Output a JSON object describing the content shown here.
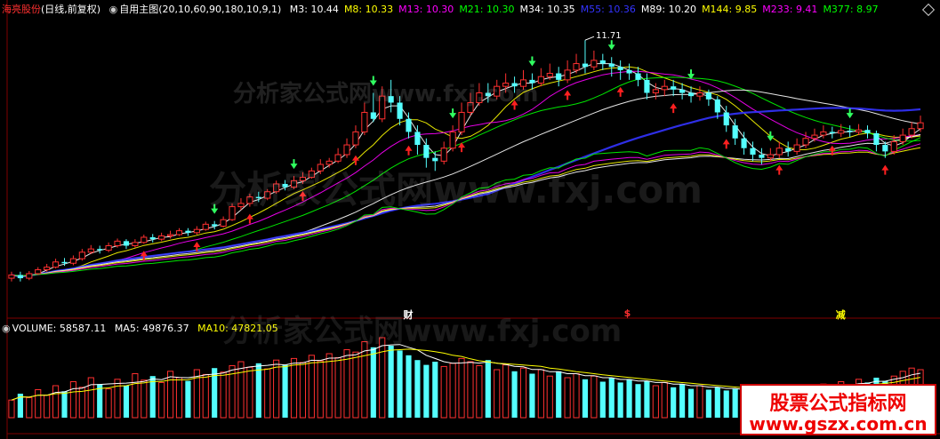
{
  "chart_data": {
    "type": "candlestick",
    "stock_name": "海亮股份",
    "period_label": "(日线,前复权)",
    "formula_name": "自用主图(20,10,60,90,180,10,9,1)",
    "high_marker": "11.71",
    "ma_legend": [
      {
        "label": "M3: 10.44",
        "color": "#ffffff"
      },
      {
        "label": "M8: 10.33",
        "color": "#ffff00"
      },
      {
        "label": "M13: 10.30",
        "color": "#ff00ff"
      },
      {
        "label": "M21: 10.30",
        "color": "#00ff00"
      },
      {
        "label": "M34: 10.35",
        "color": "#ffffff"
      },
      {
        "label": "M55: 10.36",
        "color": "#3333ff"
      },
      {
        "label": "M89: 10.20",
        "color": "#ffffff"
      },
      {
        "label": "M144: 9.85",
        "color": "#ffff00"
      },
      {
        "label": "M233: 9.41",
        "color": "#ff00ff"
      },
      {
        "label": "M377: 8.97",
        "color": "#00ff00"
      }
    ],
    "events": [
      {
        "label": "财",
        "color": "#ffffff",
        "index": 45
      },
      {
        "label": "$",
        "color": "#ff3030",
        "index": 70
      },
      {
        "label": "减",
        "color": "#ffff00",
        "index": 94
      }
    ],
    "candles": [
      [
        8.05,
        8.1,
        8.15,
        8.0
      ],
      [
        8.1,
        8.05,
        8.15,
        8.0
      ],
      [
        8.05,
        8.12,
        8.16,
        8.02
      ],
      [
        8.12,
        8.18,
        8.22,
        8.1
      ],
      [
        8.18,
        8.22,
        8.27,
        8.15
      ],
      [
        8.22,
        8.3,
        8.35,
        8.2
      ],
      [
        8.3,
        8.28,
        8.36,
        8.24
      ],
      [
        8.28,
        8.35,
        8.4,
        8.25
      ],
      [
        8.35,
        8.45,
        8.5,
        8.32
      ],
      [
        8.45,
        8.5,
        8.56,
        8.42
      ],
      [
        8.5,
        8.48,
        8.55,
        8.43
      ],
      [
        8.48,
        8.55,
        8.6,
        8.45
      ],
      [
        8.55,
        8.62,
        8.66,
        8.52
      ],
      [
        8.62,
        8.55,
        8.65,
        8.5
      ],
      [
        8.55,
        8.6,
        8.65,
        8.52
      ],
      [
        8.6,
        8.68,
        8.72,
        8.58
      ],
      [
        8.68,
        8.65,
        8.73,
        8.6
      ],
      [
        8.65,
        8.7,
        8.75,
        8.62
      ],
      [
        8.7,
        8.72,
        8.78,
        8.66
      ],
      [
        8.72,
        8.78,
        8.82,
        8.7
      ],
      [
        8.78,
        8.75,
        8.82,
        8.7
      ],
      [
        8.75,
        8.8,
        8.85,
        8.72
      ],
      [
        8.8,
        8.88,
        8.92,
        8.78
      ],
      [
        8.88,
        8.85,
        8.93,
        8.8
      ],
      [
        8.85,
        8.95,
        9.0,
        8.83
      ],
      [
        8.95,
        9.15,
        9.2,
        8.93
      ],
      [
        9.15,
        9.2,
        9.28,
        9.1
      ],
      [
        9.2,
        9.3,
        9.35,
        9.15
      ],
      [
        9.3,
        9.28,
        9.38,
        9.22
      ],
      [
        9.28,
        9.38,
        9.42,
        9.25
      ],
      [
        9.38,
        9.5,
        9.55,
        9.35
      ],
      [
        9.5,
        9.45,
        9.56,
        9.4
      ],
      [
        9.45,
        9.55,
        9.62,
        9.42
      ],
      [
        9.55,
        9.6,
        9.68,
        9.5
      ],
      [
        9.6,
        9.7,
        9.75,
        9.58
      ],
      [
        9.7,
        9.8,
        9.88,
        9.65
      ],
      [
        9.8,
        9.85,
        9.9,
        9.75
      ],
      [
        9.85,
        9.95,
        10.05,
        9.82
      ],
      [
        9.95,
        10.1,
        10.2,
        9.9
      ],
      [
        10.1,
        10.3,
        10.4,
        10.05
      ],
      [
        10.3,
        10.6,
        10.75,
        10.25
      ],
      [
        10.6,
        10.5,
        10.9,
        10.45
      ],
      [
        10.5,
        10.85,
        11.0,
        10.45
      ],
      [
        10.85,
        10.75,
        11.1,
        10.6
      ],
      [
        10.75,
        10.5,
        10.85,
        10.4
      ],
      [
        10.5,
        10.3,
        10.6,
        10.2
      ],
      [
        10.3,
        10.1,
        10.4,
        9.95
      ],
      [
        10.1,
        9.9,
        10.2,
        9.75
      ],
      [
        9.9,
        9.85,
        10.0,
        9.7
      ],
      [
        9.85,
        10.05,
        10.15,
        9.8
      ],
      [
        10.05,
        10.3,
        10.4,
        10.0
      ],
      [
        10.3,
        10.6,
        10.75,
        10.25
      ],
      [
        10.6,
        10.75,
        10.9,
        10.55
      ],
      [
        10.75,
        10.9,
        11.05,
        10.7
      ],
      [
        10.9,
        10.85,
        11.05,
        10.75
      ],
      [
        10.85,
        11.0,
        11.1,
        10.8
      ],
      [
        11.0,
        11.05,
        11.2,
        10.9
      ],
      [
        11.05,
        11.0,
        11.15,
        10.9
      ],
      [
        11.0,
        11.1,
        11.25,
        10.95
      ],
      [
        11.1,
        11.05,
        11.2,
        10.95
      ],
      [
        11.05,
        11.15,
        11.28,
        11.0
      ],
      [
        11.15,
        11.2,
        11.35,
        11.1
      ],
      [
        11.2,
        11.1,
        11.3,
        11.0
      ],
      [
        11.1,
        11.25,
        11.4,
        11.05
      ],
      [
        11.25,
        11.35,
        11.5,
        11.2
      ],
      [
        11.35,
        11.3,
        11.71,
        11.2
      ],
      [
        11.3,
        11.4,
        11.55,
        11.25
      ],
      [
        11.4,
        11.35,
        11.5,
        11.25
      ],
      [
        11.35,
        11.3,
        11.45,
        11.15
      ],
      [
        11.3,
        11.25,
        11.4,
        11.1
      ],
      [
        11.25,
        11.2,
        11.35,
        11.1
      ],
      [
        11.2,
        11.1,
        11.3,
        11.0
      ],
      [
        11.1,
        10.9,
        11.2,
        10.8
      ],
      [
        10.9,
        10.95,
        11.05,
        10.8
      ],
      [
        10.95,
        11.0,
        11.1,
        10.85
      ],
      [
        11.0,
        10.95,
        11.1,
        10.85
      ],
      [
        10.95,
        10.9,
        11.05,
        10.8
      ],
      [
        10.9,
        10.85,
        11.0,
        10.75
      ],
      [
        10.85,
        10.9,
        11.0,
        10.78
      ],
      [
        10.9,
        10.8,
        10.95,
        10.7
      ],
      [
        10.8,
        10.6,
        10.85,
        10.5
      ],
      [
        10.6,
        10.4,
        10.7,
        10.3
      ],
      [
        10.4,
        10.2,
        10.5,
        10.1
      ],
      [
        10.2,
        10.05,
        10.3,
        9.95
      ],
      [
        10.05,
        9.95,
        10.15,
        9.85
      ],
      [
        9.95,
        9.9,
        10.05,
        9.8
      ],
      [
        9.9,
        9.95,
        10.05,
        9.85
      ],
      [
        9.95,
        10.05,
        10.15,
        9.9
      ],
      [
        10.05,
        10.0,
        10.15,
        9.92
      ],
      [
        10.0,
        10.1,
        10.2,
        9.95
      ],
      [
        10.1,
        10.2,
        10.3,
        10.05
      ],
      [
        10.2,
        10.25,
        10.35,
        10.15
      ],
      [
        10.25,
        10.3,
        10.4,
        10.2
      ],
      [
        10.3,
        10.28,
        10.38,
        10.2
      ],
      [
        10.28,
        10.32,
        10.42,
        10.22
      ],
      [
        10.32,
        10.3,
        10.4,
        10.22
      ],
      [
        10.3,
        10.33,
        10.42,
        10.25
      ],
      [
        10.33,
        10.28,
        10.4,
        10.2
      ],
      [
        10.28,
        10.1,
        10.32,
        10.0
      ],
      [
        10.1,
        10.0,
        10.15,
        9.9
      ],
      [
        10.0,
        10.15,
        10.25,
        9.95
      ],
      [
        10.15,
        10.25,
        10.35,
        10.1
      ],
      [
        10.25,
        10.35,
        10.45,
        10.2
      ],
      [
        10.35,
        10.44,
        10.55,
        10.3
      ]
    ],
    "volume": {
      "label_volume": "VOLUME: 58587.11",
      "label_ma5": "MA5: 49876.37",
      "label_ma10": "MA10: 47821.05",
      "values": [
        22,
        30,
        25,
        35,
        28,
        40,
        33,
        45,
        38,
        50,
        42,
        36,
        48,
        40,
        55,
        47,
        52,
        44,
        58,
        50,
        46,
        60,
        54,
        62,
        57,
        65,
        70,
        63,
        68,
        61,
        72,
        66,
        74,
        69,
        78,
        71,
        80,
        75,
        85,
        82,
        95,
        88,
        100,
        90,
        84,
        78,
        72,
        66,
        70,
        64,
        68,
        74,
        70,
        65,
        72,
        60,
        66,
        58,
        62,
        55,
        60,
        52,
        58,
        50,
        55,
        48,
        52,
        45,
        50,
        44,
        48,
        42,
        46,
        40,
        44,
        38,
        42,
        36,
        40,
        35,
        38,
        34,
        36,
        32,
        35,
        33,
        37,
        34,
        38,
        35,
        40,
        36,
        42,
        38,
        45,
        40,
        48,
        44,
        50,
        46,
        52,
        58,
        62,
        60
      ]
    },
    "price_range": [
      7.6,
      12.0
    ],
    "volume_max": 100
  },
  "watermark": "分析家公式网www.fxj.com",
  "badge": {
    "line1": "股票公式指标网",
    "line2": "www.gszx.com.cn"
  },
  "colors": {
    "up": "#ff3030",
    "down": "#54ffff",
    "bg": "#000000",
    "grid": "#800000"
  }
}
